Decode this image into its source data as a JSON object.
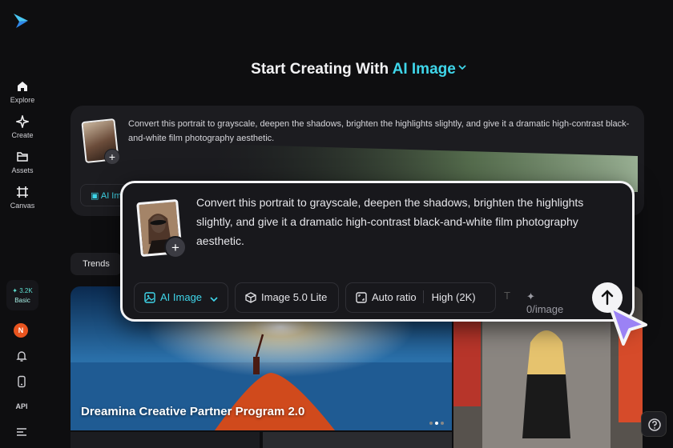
{
  "sidebar": {
    "items": [
      {
        "label": "Explore",
        "icon": "home-icon"
      },
      {
        "label": "Create",
        "icon": "sparkle-icon"
      },
      {
        "label": "Assets",
        "icon": "folder-icon"
      },
      {
        "label": "Canvas",
        "icon": "canvas-icon"
      }
    ],
    "credits": {
      "amount": "3.2K",
      "plan": "Basic"
    },
    "user_initial": "N",
    "api_label": "API"
  },
  "header": {
    "prefix": "Start Creating With",
    "mode": "AI Image"
  },
  "prompt": {
    "text": "Convert this portrait to grayscale, deepen the shadows, brighten the highlights slightly, and give it a dramatic high-contrast black-and-white film photography aesthetic."
  },
  "toolbar": {
    "mode_label": "AI Image",
    "model_label": "Image 5.0 Lite",
    "ratio_label": "Auto ratio",
    "quality_label": "High (2K)",
    "cost_label": "0/image"
  },
  "background_chip": "AI Ima",
  "tabs": {
    "trends": "Trends"
  },
  "gallery": {
    "feature_title": "Dreamina Creative Partner Program 2.0"
  },
  "colors": {
    "accent": "#3fd6ea",
    "background": "#0e0e10",
    "panel": "#18181c"
  }
}
